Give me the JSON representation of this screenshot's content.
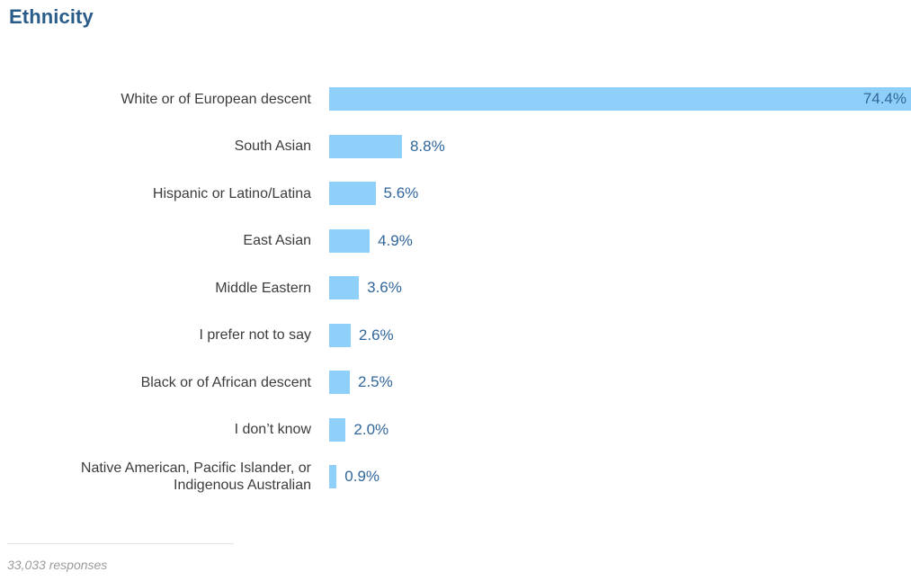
{
  "title": "Ethnicity",
  "footer": {
    "note": "33,033 responses"
  },
  "colors": {
    "title": "#2a5c8a",
    "bar": "#8fd0fa",
    "value_text": "#31669a",
    "label_text": "#3c3c3c",
    "footer_text": "#9b9b9b",
    "divider": "#e2e2e6",
    "background": "#ffffff"
  },
  "chart_data": {
    "type": "bar",
    "orientation": "horizontal",
    "title": "Ethnicity",
    "xlabel": "",
    "ylabel": "",
    "grid": false,
    "legend": "none",
    "value_suffix": "%",
    "xlim": [
      0,
      74.4
    ],
    "categories": [
      "White or of European descent",
      "South Asian",
      "Hispanic or Latino/Latina",
      "East Asian",
      "Middle Eastern",
      "I prefer not to say",
      "Black or of African descent",
      "I don’t know",
      "Native American, Pacific Islander, or\nIndigenous Australian"
    ],
    "values": [
      74.4,
      8.8,
      5.6,
      4.9,
      3.6,
      2.6,
      2.5,
      2.0,
      0.9
    ],
    "value_labels": [
      "74.4%",
      "8.8%",
      "5.6%",
      "4.9%",
      "3.6%",
      "2.6%",
      "2.5%",
      "2.0%",
      "0.9%"
    ],
    "label_positions": [
      "inside",
      "outside",
      "outside",
      "outside",
      "outside",
      "outside",
      "outside",
      "outside",
      "outside"
    ],
    "annotations": [
      "33,033 responses"
    ]
  }
}
